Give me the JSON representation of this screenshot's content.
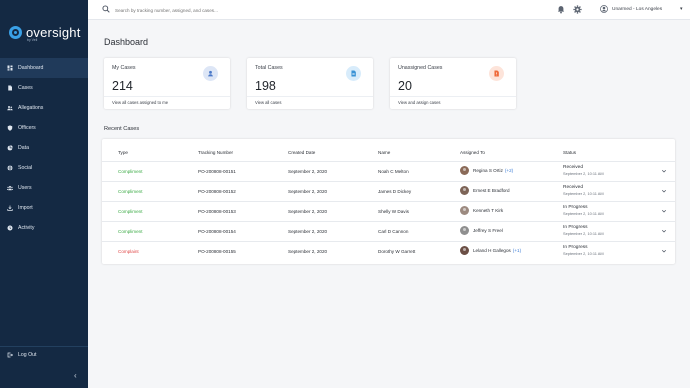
{
  "brand": {
    "name": "oversight",
    "sub": "by Veil"
  },
  "sidebar": {
    "items": [
      {
        "label": "Dashboard",
        "icon": "dashboard-icon",
        "active": true
      },
      {
        "label": "Cases",
        "icon": "document-icon",
        "active": false
      },
      {
        "label": "Allegations",
        "icon": "people-icon",
        "active": false
      },
      {
        "label": "Officers",
        "icon": "shield-icon",
        "active": false
      },
      {
        "label": "Data",
        "icon": "pie-chart-icon",
        "active": false
      },
      {
        "label": "Social",
        "icon": "globe-icon",
        "active": false
      },
      {
        "label": "Users",
        "icon": "users-icon",
        "active": false
      },
      {
        "label": "Import",
        "icon": "import-icon",
        "active": false
      },
      {
        "label": "Activity",
        "icon": "activity-icon",
        "active": false
      }
    ],
    "logout": "Log Out"
  },
  "topbar": {
    "search_placeholder": "Search by tracking number, assigned, and cases...",
    "user": "Unarmed - Los Angeles"
  },
  "main": {
    "title": "Dashboard",
    "cards": [
      {
        "title": "My Cases",
        "value": "214",
        "link": "View all cases assigned to me",
        "icon": "person-icon",
        "badge_color": "#dde6f6",
        "icon_color": "#4a78c8"
      },
      {
        "title": "Total Cases",
        "value": "198",
        "link": "View all cases",
        "icon": "document-icon",
        "badge_color": "#d8ecfb",
        "icon_color": "#3a93d6"
      },
      {
        "title": "Unassigned Cases",
        "value": "20",
        "link": "View and assign cases",
        "icon": "document-alert-icon",
        "badge_color": "#fde4da",
        "icon_color": "#ef6a3a"
      }
    ],
    "recent_title": "Recent Cases",
    "table": {
      "headers": [
        "Type",
        "Tracking Number",
        "Created Date",
        "Name",
        "Assigned To",
        "Status"
      ],
      "rows": [
        {
          "type": "Compliment",
          "tracking": "PO-200808-00151",
          "date": "September 2, 2020",
          "name": "Noah C Melton",
          "assigned": "Regina S Ortiz",
          "extra": "(+2)",
          "avatar": "#8a6a58",
          "status": "Received",
          "status_date": "September 2, 10:11 AM"
        },
        {
          "type": "Compliment",
          "tracking": "PO-200808-00152",
          "date": "September 2, 2020",
          "name": "James D Dickey",
          "assigned": "Ernest E Bradford",
          "extra": "",
          "avatar": "#7d6457",
          "status": "Received",
          "status_date": "September 2, 10:11 AM"
        },
        {
          "type": "Compliment",
          "tracking": "PO-200808-00153",
          "date": "September 2, 2020",
          "name": "Shelly W Davis",
          "assigned": "Kenneth T Kirk",
          "extra": "",
          "avatar": "#9c8a80",
          "status": "In Progress",
          "status_date": "September 2, 10:11 AM"
        },
        {
          "type": "Compliment",
          "tracking": "PO-200808-00154",
          "date": "September 2, 2020",
          "name": "Carl D Cannon",
          "assigned": "Jeffrey S Freel",
          "extra": "",
          "avatar": "#8f8f8f",
          "status": "In Progress",
          "status_date": "September 2, 10:11 AM"
        },
        {
          "type": "Complaint",
          "tracking": "PO-200808-00155",
          "date": "September 2, 2020",
          "name": "Dorothy W Garrett",
          "assigned": "Leland H Gallegos",
          "extra": "(+1)",
          "avatar": "#6b4f45",
          "status": "In Progress",
          "status_date": "September 2, 10:11 AM"
        }
      ]
    }
  },
  "colors": {
    "sidebar": "#142943",
    "compliment": "#3bab45",
    "complaint": "#e04848",
    "link_blue": "#3a7bd5"
  }
}
